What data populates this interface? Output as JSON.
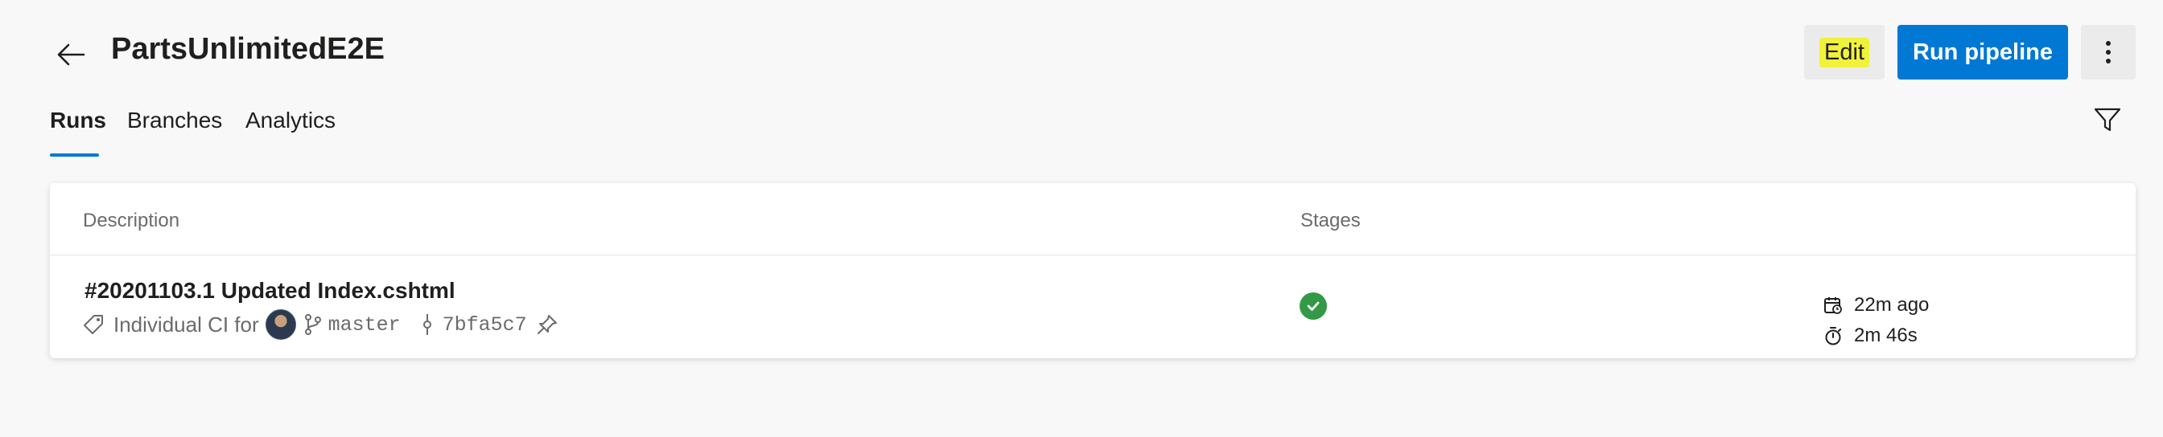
{
  "header": {
    "title": "PartsUnlimitedE2E",
    "edit_label": "Edit",
    "run_label": "Run pipeline"
  },
  "tabs": [
    {
      "label": "Runs",
      "selected": true
    },
    {
      "label": "Branches",
      "selected": false
    },
    {
      "label": "Analytics",
      "selected": false
    }
  ],
  "table": {
    "columns": [
      "Description",
      "Stages"
    ],
    "rows": [
      {
        "title": "#20201103.1 Updated Index.cshtml",
        "trigger": "Individual CI for",
        "branch": "master",
        "commit": "7bfa5c7",
        "stage_status": "succeeded",
        "time_ago": "22m ago",
        "duration": "2m 46s"
      }
    ]
  },
  "colors": {
    "accent": "#0078d4",
    "success": "#339947",
    "highlight": "#f1f23a"
  },
  "icons": [
    "arrow-left-icon",
    "more-vertical-icon",
    "filter-icon",
    "tag-icon",
    "avatar",
    "branch-icon",
    "commit-icon",
    "pin-icon",
    "checkmark-circle-icon",
    "calendar-icon",
    "timer-icon"
  ]
}
